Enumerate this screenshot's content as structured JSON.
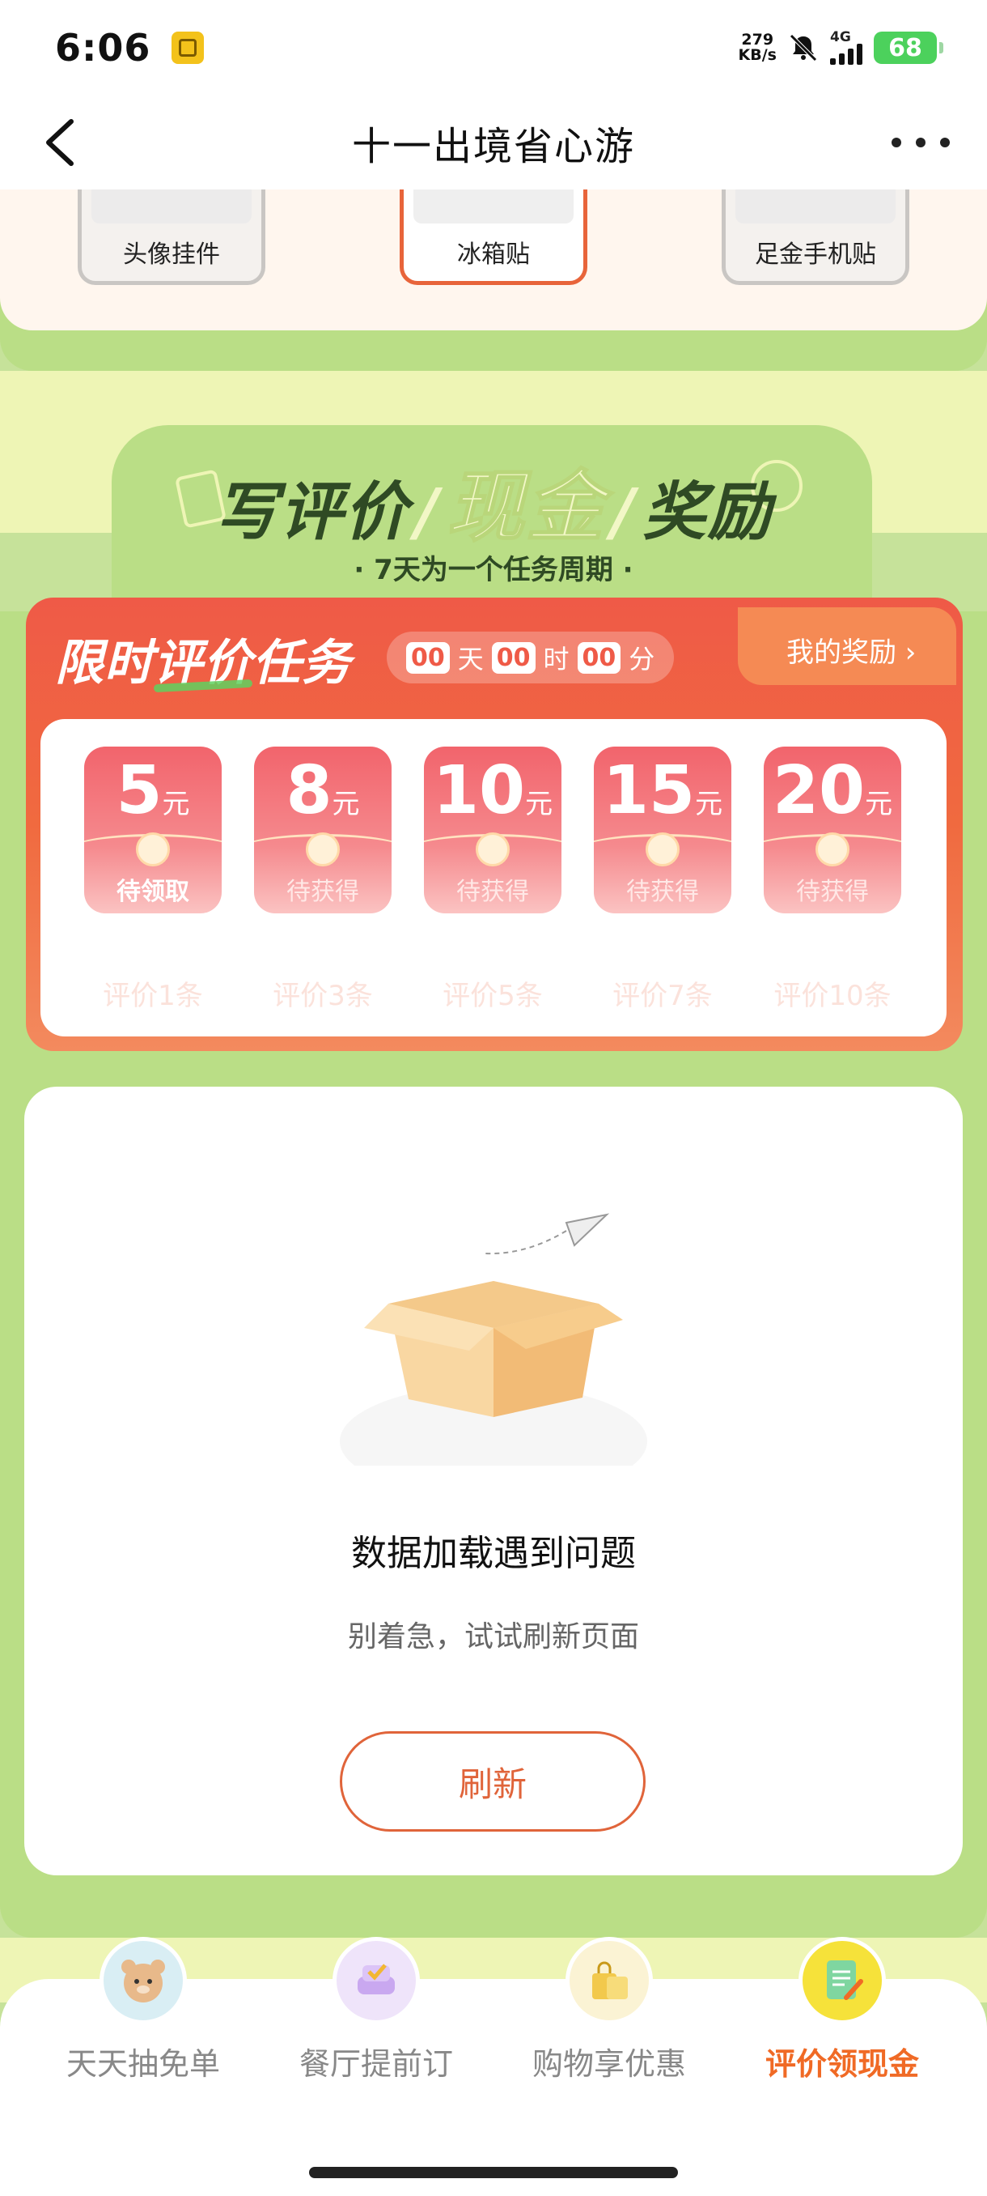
{
  "status_bar": {
    "time": "6:06",
    "speed_value": "279",
    "speed_unit": "KB/s",
    "network": "4G",
    "battery": "68"
  },
  "nav": {
    "title": "十一出境省心游"
  },
  "top_prizes": [
    {
      "label": "头像挂件",
      "active": false
    },
    {
      "label": "冰箱贴",
      "active": true
    },
    {
      "label": "足金手机贴",
      "active": false
    }
  ],
  "header": {
    "title_part1": "写评价",
    "title_part2": "现金",
    "title_part3": "奖励",
    "subtitle": "· 7天为一个任务周期 ·"
  },
  "task": {
    "title_a": "限时",
    "title_b": "评价",
    "title_c": "任务",
    "countdown": {
      "days": "00",
      "days_unit": "天",
      "hours": "00",
      "hours_unit": "时",
      "minutes": "00",
      "minutes_unit": "分"
    },
    "my_reward": "我的奖励 ›",
    "currency_unit": "元",
    "rewards": [
      {
        "amount": "5",
        "status": "待领取",
        "requirement": "评价1条"
      },
      {
        "amount": "8",
        "status": "待获得",
        "requirement": "评价3条"
      },
      {
        "amount": "10",
        "status": "待获得",
        "requirement": "评价5条"
      },
      {
        "amount": "15",
        "status": "待获得",
        "requirement": "评价7条"
      },
      {
        "amount": "20",
        "status": "待获得",
        "requirement": "评价10条"
      }
    ]
  },
  "error": {
    "title": "数据加载遇到问题",
    "subtitle": "别着急，试试刷新页面",
    "button": "刷新"
  },
  "tabs": [
    {
      "label": "天天抽免单",
      "icon": "bear-icon",
      "selected": false
    },
    {
      "label": "餐厅提前订",
      "icon": "sofa-icon",
      "selected": false
    },
    {
      "label": "购物享优惠",
      "icon": "shopping-bag-icon",
      "selected": false
    },
    {
      "label": "评价领现金",
      "icon": "notepad-icon",
      "selected": true
    }
  ],
  "colors": {
    "accent": "#f06a25",
    "green": "#bade86",
    "red": "#ef5a47"
  }
}
